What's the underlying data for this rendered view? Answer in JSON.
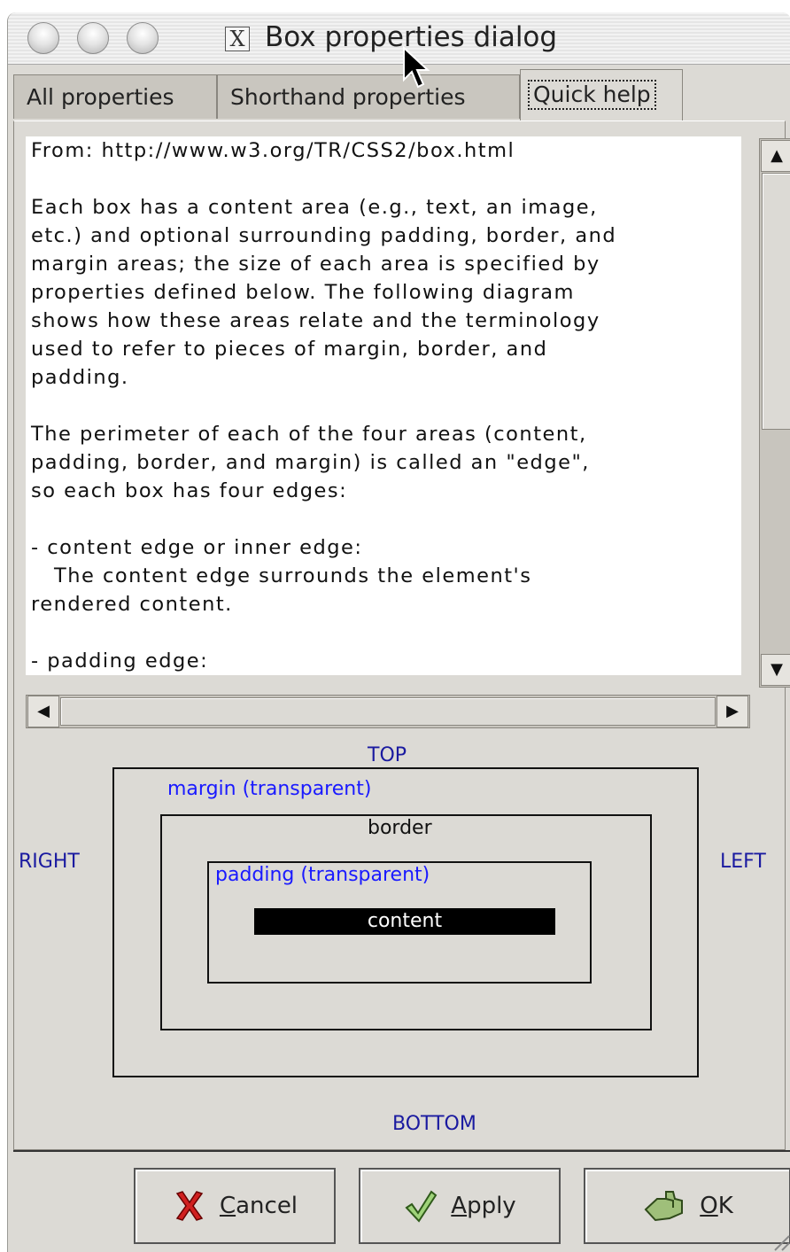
{
  "window": {
    "title": "Box properties dialog"
  },
  "tabs": [
    {
      "label": "All properties"
    },
    {
      "label": "Shorthand properties"
    },
    {
      "label": "Quick help"
    }
  ],
  "help": {
    "lines": [
      "From: http://www.w3.org/TR/CSS2/box.html",
      "",
      "Each box has a content area (e.g., text, an image,",
      "etc.) and optional surrounding padding, border, and",
      "margin areas; the size of each area is specified by",
      "properties defined below. The following diagram",
      "shows how these areas relate and the terminology",
      "used to refer to pieces of margin, border, and",
      "padding.",
      "",
      "The perimeter of each of the four areas (content,",
      "padding, border, and margin) is called an \"edge\",",
      "so each box has four edges:",
      "",
      "- content edge or inner edge:",
      "   The content edge surrounds the element's",
      "rendered content.",
      "",
      "- padding edge:"
    ]
  },
  "diagram": {
    "top": "TOP",
    "bottom": "BOTTOM",
    "right": "RIGHT",
    "left": "LEFT",
    "margin": "margin (transparent)",
    "border": "border",
    "padding": "padding (transparent)",
    "content": "content",
    "colors": {
      "label": "#1a1aa0",
      "box_label": "#1a1aff",
      "content_bg": "#000000"
    }
  },
  "buttons": {
    "cancel": {
      "mnemonic": "C",
      "rest": "ancel",
      "icon": "red-x-icon"
    },
    "apply": {
      "mnemonic": "A",
      "rest": "pply",
      "icon": "checkmark-icon"
    },
    "ok": {
      "mnemonic": "O",
      "rest": "K",
      "icon": "hand-pointer-icon"
    }
  }
}
